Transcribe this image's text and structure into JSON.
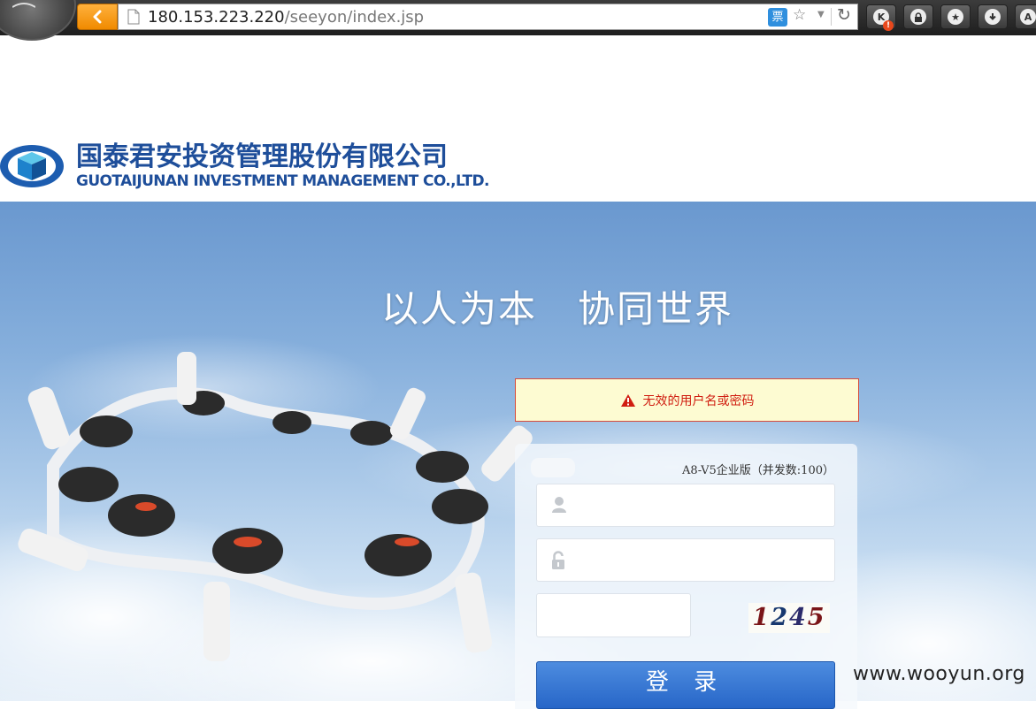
{
  "browser": {
    "url_host": "180.153.223.220",
    "url_path": "/seeyon/index.jsp",
    "ticket_icon_label": "票",
    "extensions": [
      {
        "name": "k-extension-icon",
        "glyph": "K",
        "badge": "!"
      },
      {
        "name": "lock-extension-icon",
        "glyph": "🔒"
      },
      {
        "name": "star-extension-icon",
        "glyph": "★"
      },
      {
        "name": "download-extension-icon",
        "glyph": "⬇"
      },
      {
        "name": "a-extension-icon",
        "glyph": "A"
      }
    ]
  },
  "header": {
    "company_name_cn": "国泰君安投资管理股份有限公司",
    "company_name_en": "GUOTAIJUNAN INVESTMENT MANAGEMENT CO.,LTD.",
    "brand_color": "#1e4e9a"
  },
  "hero": {
    "slogan": "以人为本   协同世界"
  },
  "error": {
    "message": "无效的用户名或密码",
    "color": "#d01d10"
  },
  "login": {
    "edition": "A8-V5企业版（并发数:100）",
    "username_value": "",
    "password_value": "",
    "captcha_value": "",
    "captcha_text": [
      "1",
      "2",
      "4",
      "5"
    ],
    "submit_label": "登 录",
    "button_color": "#2f6fcf"
  },
  "watermark": "www.wooyun.org"
}
